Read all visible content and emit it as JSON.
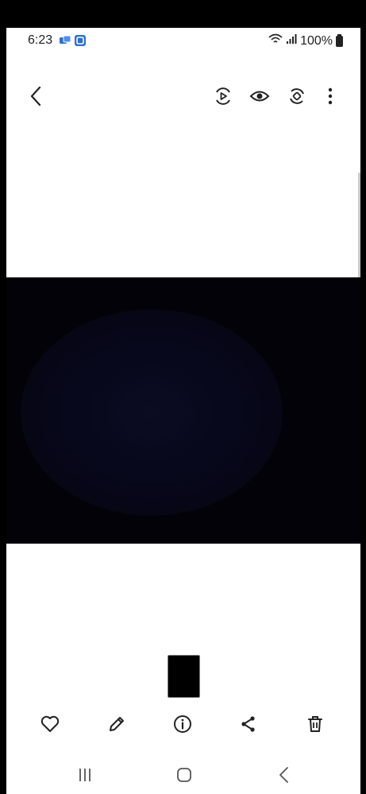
{
  "status_bar": {
    "time": "6:23",
    "battery_text": "100%",
    "icons": [
      "notification-app-icon",
      "notification-app-icon-2",
      "wifi-icon",
      "signal-icon",
      "battery-icon"
    ]
  },
  "top_bar": {
    "icons": [
      "back-icon",
      "motion-photo-icon",
      "view-icon",
      "remaster-icon",
      "more-options-icon"
    ]
  },
  "action_bar": {
    "icons": [
      "favorite-icon",
      "edit-icon",
      "info-icon",
      "share-icon",
      "delete-icon"
    ]
  },
  "nav_bar": {
    "icons": [
      "recent-apps-icon",
      "home-icon",
      "nav-back-icon"
    ]
  },
  "colors": {
    "image_background": "#020208",
    "screen_background": "#ffffff",
    "icon": "#222222"
  }
}
